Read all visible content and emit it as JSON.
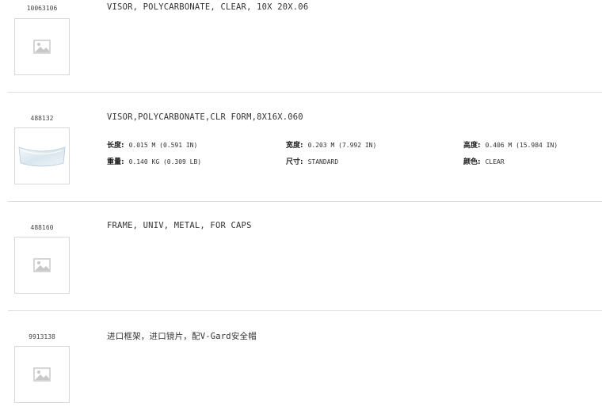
{
  "products": [
    {
      "sku": "10063106",
      "title": "VISOR, POLYCARBONATE, CLEAR, 10X 20X.06",
      "image": "placeholder-image-icon"
    },
    {
      "sku": "488132",
      "title": "VISOR,POLYCARBONATE,CLR FORM,8X16X.060",
      "image": "visor-photo",
      "specs": [
        {
          "label": "长度:",
          "value": "0.015 M (0.591 IN)"
        },
        {
          "label": "宽度:",
          "value": "0.203 M (7.992 IN)"
        },
        {
          "label": "高度:",
          "value": "0.406 M (15.984 IN)"
        },
        {
          "label": "重量:",
          "value": "0.140 KG (0.309 LB)"
        },
        {
          "label": "尺寸:",
          "value": "STANDARD"
        },
        {
          "label": "颜色:",
          "value": "CLEAR"
        }
      ]
    },
    {
      "sku": "488160",
      "title": "FRAME, UNIV, METAL, FOR CAPS",
      "image": "placeholder-image-icon"
    },
    {
      "sku": "9913138",
      "title": "进口框架，进口镜片，配V-Gard安全帽",
      "image": "placeholder-image-icon"
    }
  ]
}
